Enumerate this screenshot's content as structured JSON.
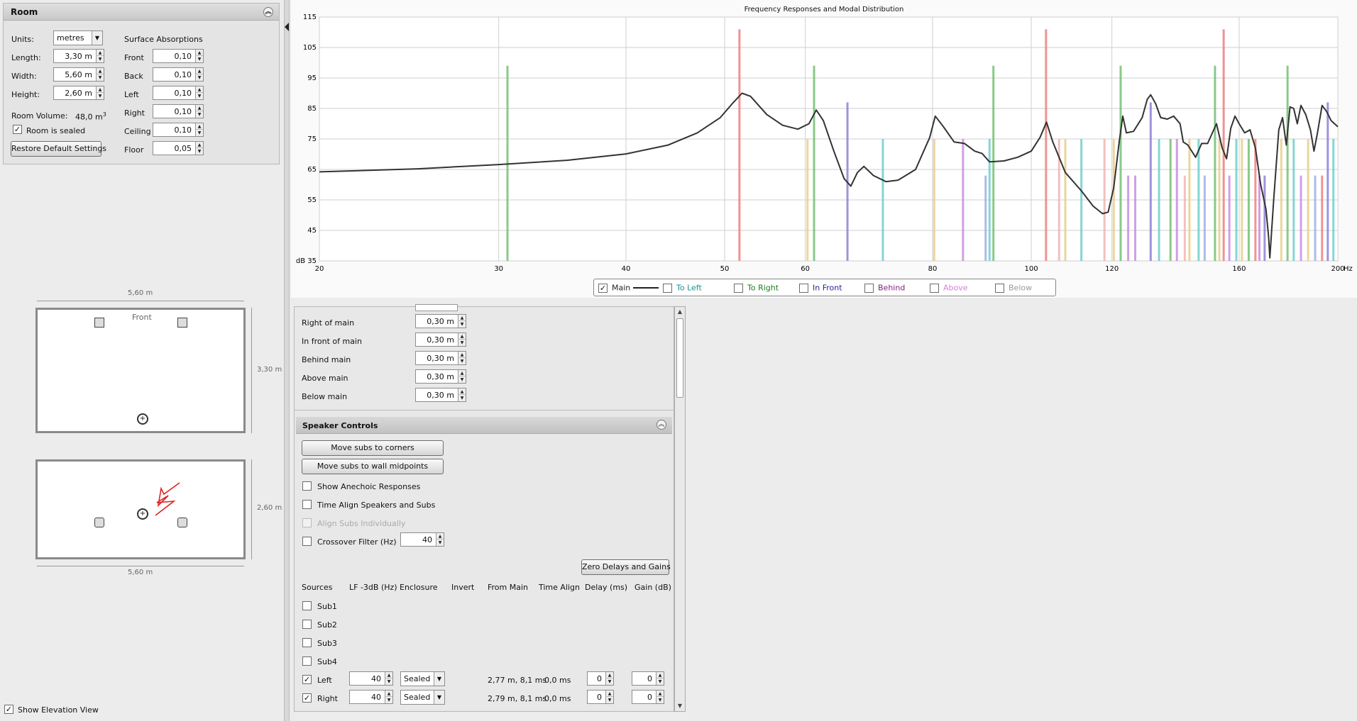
{
  "room": {
    "title": "Room",
    "units_label": "Units:",
    "units_value": "metres",
    "length_label": "Length:",
    "length_value": "3,30 m",
    "width_label": "Width:",
    "width_value": "5,60 m",
    "height_label": "Height:",
    "height_value": "2,60 m",
    "volume_label": "Room Volume:",
    "volume_value": "48,0 m",
    "volume_unit_sup": "3",
    "sealed_label": "Room is sealed",
    "sealed_checked": "✓",
    "restore_label": "Restore Default Settings",
    "absorptions_title": "Surface Absorptions",
    "absorptions": [
      {
        "label": "Front",
        "value": "0,10"
      },
      {
        "label": "Back",
        "value": "0,10"
      },
      {
        "label": "Left",
        "value": "0,10"
      },
      {
        "label": "Right",
        "value": "0,10"
      },
      {
        "label": "Ceiling",
        "value": "0,10"
      },
      {
        "label": "Floor",
        "value": "0,05"
      }
    ]
  },
  "plan": {
    "top_width": "5,60 m",
    "front_label": "Front",
    "side_length": "3,30 m",
    "side_height": "2,60 m",
    "bottom_width": "5,60 m"
  },
  "elevation": {
    "label": "Show Elevation View",
    "checked": "✓"
  },
  "offsets": [
    {
      "label": "Right of main",
      "value": "0,30 m"
    },
    {
      "label": "In front of main",
      "value": "0,30 m"
    },
    {
      "label": "Behind main",
      "value": "0,30 m"
    },
    {
      "label": "Above main",
      "value": "0,30 m"
    },
    {
      "label": "Below main",
      "value": "0,30 m"
    }
  ],
  "speaker_controls": {
    "title": "Speaker Controls",
    "move_corners": "Move subs to corners",
    "move_midpoints": "Move subs to wall midpoints",
    "show_anechoic": "Show Anechoic Responses",
    "time_align": "Time Align Speakers and Subs",
    "align_subs": "Align Subs Individually",
    "crossover": "Crossover Filter (Hz)",
    "crossover_value": "40",
    "zero_delays": "Zero Delays and Gains",
    "columns": [
      "Sources",
      "LF -3dB (Hz)",
      "Enclosure",
      "Invert",
      "From Main",
      "Time Align",
      "Delay (ms)",
      "Gain (dB)"
    ],
    "subs": [
      {
        "name": "Sub1",
        "checked": ""
      },
      {
        "name": "Sub2",
        "checked": ""
      },
      {
        "name": "Sub3",
        "checked": ""
      },
      {
        "name": "Sub4",
        "checked": ""
      }
    ],
    "speakers": [
      {
        "name": "Left",
        "checked": "✓",
        "lf": "40",
        "enclosure": "Sealed",
        "from_main": "2,77 m, 8,1 ms",
        "time_align": "0,0 ms",
        "delay": "0",
        "gain": "0"
      },
      {
        "name": "Right",
        "checked": "✓",
        "lf": "40",
        "enclosure": "Sealed",
        "from_main": "2,79 m, 8,1 ms",
        "time_align": "0,0 ms",
        "delay": "0",
        "gain": "0"
      }
    ]
  },
  "legend": {
    "items": [
      {
        "label": "Main",
        "checked": "✓",
        "color": "#222222"
      },
      {
        "label": "To Left",
        "checked": "",
        "color": "#1f8f8f"
      },
      {
        "label": "To Right",
        "checked": "",
        "color": "#1f7a1f"
      },
      {
        "label": "In Front",
        "checked": "",
        "color": "#1f1f9a"
      },
      {
        "label": "Behind",
        "checked": "",
        "color": "#7a1f7a"
      },
      {
        "label": "Above",
        "checked": "",
        "color": "#d27fd2"
      },
      {
        "label": "Below",
        "checked": "",
        "color": "#9a9a9a"
      }
    ]
  },
  "chart_data": {
    "type": "line",
    "title": "Frequency Responses and Modal Distribution",
    "xscale": "log",
    "xlim": [
      20,
      200
    ],
    "ylim": [
      35,
      115
    ],
    "x_ticks": [
      20,
      30,
      40,
      50,
      60,
      80,
      100,
      120,
      160,
      200
    ],
    "y_ticks": [
      35,
      45,
      55,
      65,
      75,
      85,
      95,
      105,
      115
    ],
    "x_unit": "Hz",
    "y_unit": "dB",
    "grid": true,
    "series": [
      {
        "name": "Main",
        "color": "#333333",
        "points": [
          [
            20,
            64.2
          ],
          [
            25,
            65.2
          ],
          [
            30,
            66.6
          ],
          [
            35,
            68
          ],
          [
            40,
            70.1
          ],
          [
            44,
            73
          ],
          [
            47,
            77
          ],
          [
            49.5,
            82
          ],
          [
            51,
            87
          ],
          [
            52,
            90
          ],
          [
            53,
            89
          ],
          [
            55,
            83
          ],
          [
            57,
            79.5
          ],
          [
            59,
            78.2
          ],
          [
            60.5,
            80
          ],
          [
            61.5,
            84.5
          ],
          [
            62.5,
            81
          ],
          [
            64,
            71
          ],
          [
            65.5,
            62
          ],
          [
            66.5,
            59.5
          ],
          [
            67.5,
            64
          ],
          [
            68.5,
            66
          ],
          [
            70,
            63
          ],
          [
            72,
            61
          ],
          [
            74,
            61.5
          ],
          [
            77,
            65
          ],
          [
            79.5,
            75.5
          ],
          [
            80.5,
            82.5
          ],
          [
            82,
            79
          ],
          [
            84,
            74
          ],
          [
            86,
            73.5
          ],
          [
            88,
            71
          ],
          [
            89.5,
            70.2
          ],
          [
            91,
            67.5
          ],
          [
            94,
            67.8
          ],
          [
            97,
            69
          ],
          [
            100,
            71
          ],
          [
            102,
            75.5
          ],
          [
            103.5,
            80.5
          ],
          [
            105,
            74
          ],
          [
            108,
            64
          ],
          [
            112,
            58
          ],
          [
            115,
            53
          ],
          [
            117.5,
            50.5
          ],
          [
            119,
            51
          ],
          [
            120.5,
            59
          ],
          [
            122,
            74
          ],
          [
            123,
            82.5
          ],
          [
            124,
            77
          ],
          [
            126,
            77.5
          ],
          [
            128.5,
            82
          ],
          [
            130,
            88
          ],
          [
            131,
            89.5
          ],
          [
            132.5,
            86.5
          ],
          [
            134,
            82
          ],
          [
            136,
            81.5
          ],
          [
            138,
            82.5
          ],
          [
            140,
            80
          ],
          [
            141,
            74
          ],
          [
            142.5,
            73
          ],
          [
            145,
            69
          ],
          [
            147,
            73.5
          ],
          [
            149,
            73.5
          ],
          [
            152,
            80
          ],
          [
            154,
            72
          ],
          [
            155.5,
            68.5
          ],
          [
            157,
            78.5
          ],
          [
            158.5,
            82.5
          ],
          [
            160,
            80
          ],
          [
            162,
            77
          ],
          [
            164,
            78
          ],
          [
            166,
            72
          ],
          [
            168,
            60
          ],
          [
            170,
            52
          ],
          [
            171,
            43
          ],
          [
            171.5,
            36
          ],
          [
            173,
            55
          ],
          [
            175,
            78
          ],
          [
            176.5,
            82
          ],
          [
            178,
            73
          ],
          [
            179.5,
            85.5
          ],
          [
            181,
            85
          ],
          [
            182.5,
            80
          ],
          [
            184,
            86
          ],
          [
            186,
            83
          ],
          [
            188,
            78
          ],
          [
            189.5,
            71
          ],
          [
            191,
            77
          ],
          [
            193,
            86
          ],
          [
            195,
            84
          ],
          [
            197,
            81
          ],
          [
            200,
            79
          ]
        ]
      }
    ],
    "modes": [
      {
        "freq": 30.6,
        "level": 99,
        "color": "#74c174"
      },
      {
        "freq": 51.7,
        "level": 111,
        "color": "#ef7f7f"
      },
      {
        "freq": 60.3,
        "level": 75,
        "color": "#e8cf8a"
      },
      {
        "freq": 61.2,
        "level": 99,
        "color": "#74c174"
      },
      {
        "freq": 66.0,
        "level": 87,
        "color": "#8b82d6"
      },
      {
        "freq": 71.5,
        "level": 75,
        "color": "#6fd0cc"
      },
      {
        "freq": 80.3,
        "level": 75,
        "color": "#e8cf8a"
      },
      {
        "freq": 85.7,
        "level": 75,
        "color": "#c98ee1"
      },
      {
        "freq": 90.2,
        "level": 63,
        "color": "#9eb0e6"
      },
      {
        "freq": 91.0,
        "level": 75,
        "color": "#6fd0cc"
      },
      {
        "freq": 91.8,
        "level": 99,
        "color": "#74c174"
      },
      {
        "freq": 103.4,
        "level": 111,
        "color": "#ef7f7f"
      },
      {
        "freq": 106.5,
        "level": 75,
        "color": "#f1b6b6"
      },
      {
        "freq": 108.0,
        "level": 75,
        "color": "#e8cf8a"
      },
      {
        "freq": 112.0,
        "level": 75,
        "color": "#6fd0cc"
      },
      {
        "freq": 118.0,
        "level": 75,
        "color": "#f1b6b6"
      },
      {
        "freq": 120.5,
        "level": 75,
        "color": "#e8cf8a"
      },
      {
        "freq": 122.4,
        "level": 99,
        "color": "#74c174"
      },
      {
        "freq": 124.5,
        "level": 63,
        "color": "#c98ee1"
      },
      {
        "freq": 126.5,
        "level": 63,
        "color": "#c98ee1"
      },
      {
        "freq": 131.0,
        "level": 87,
        "color": "#8b82d6"
      },
      {
        "freq": 133.5,
        "level": 75,
        "color": "#6fd0cc"
      },
      {
        "freq": 137.0,
        "level": 75,
        "color": "#74c174"
      },
      {
        "freq": 139.0,
        "level": 75,
        "color": "#c98ee1"
      },
      {
        "freq": 141.5,
        "level": 63,
        "color": "#f1b6b6"
      },
      {
        "freq": 143.0,
        "level": 75,
        "color": "#e8cf8a"
      },
      {
        "freq": 146.0,
        "level": 75,
        "color": "#6fd0cc"
      },
      {
        "freq": 148.0,
        "level": 63,
        "color": "#9eb0e6"
      },
      {
        "freq": 151.5,
        "level": 99,
        "color": "#74c174"
      },
      {
        "freq": 153.0,
        "level": 75,
        "color": "#e8cf8a"
      },
      {
        "freq": 154.5,
        "level": 111,
        "color": "#ef7f7f"
      },
      {
        "freq": 156.5,
        "level": 63,
        "color": "#c98ee1"
      },
      {
        "freq": 159.0,
        "level": 75,
        "color": "#6fd0cc"
      },
      {
        "freq": 161.0,
        "level": 75,
        "color": "#e8cf8a"
      },
      {
        "freq": 163.5,
        "level": 75,
        "color": "#74c174"
      },
      {
        "freq": 166.0,
        "level": 75,
        "color": "#ef7f7f"
      },
      {
        "freq": 167.5,
        "level": 63,
        "color": "#c98ee1"
      },
      {
        "freq": 169.5,
        "level": 63,
        "color": "#8b82d6"
      },
      {
        "freq": 176.0,
        "level": 75,
        "color": "#e8cf8a"
      },
      {
        "freq": 178.5,
        "level": 99,
        "color": "#74c174"
      },
      {
        "freq": 181.0,
        "level": 75,
        "color": "#6fd0cc"
      },
      {
        "freq": 184.0,
        "level": 63,
        "color": "#c98ee1"
      },
      {
        "freq": 187.0,
        "level": 75,
        "color": "#e8cf8a"
      },
      {
        "freq": 190.0,
        "level": 63,
        "color": "#9eb0e6"
      },
      {
        "freq": 193.0,
        "level": 63,
        "color": "#ef7f7f"
      },
      {
        "freq": 195.5,
        "level": 87,
        "color": "#8b82d6"
      },
      {
        "freq": 198.0,
        "level": 75,
        "color": "#6fd0cc"
      }
    ]
  }
}
